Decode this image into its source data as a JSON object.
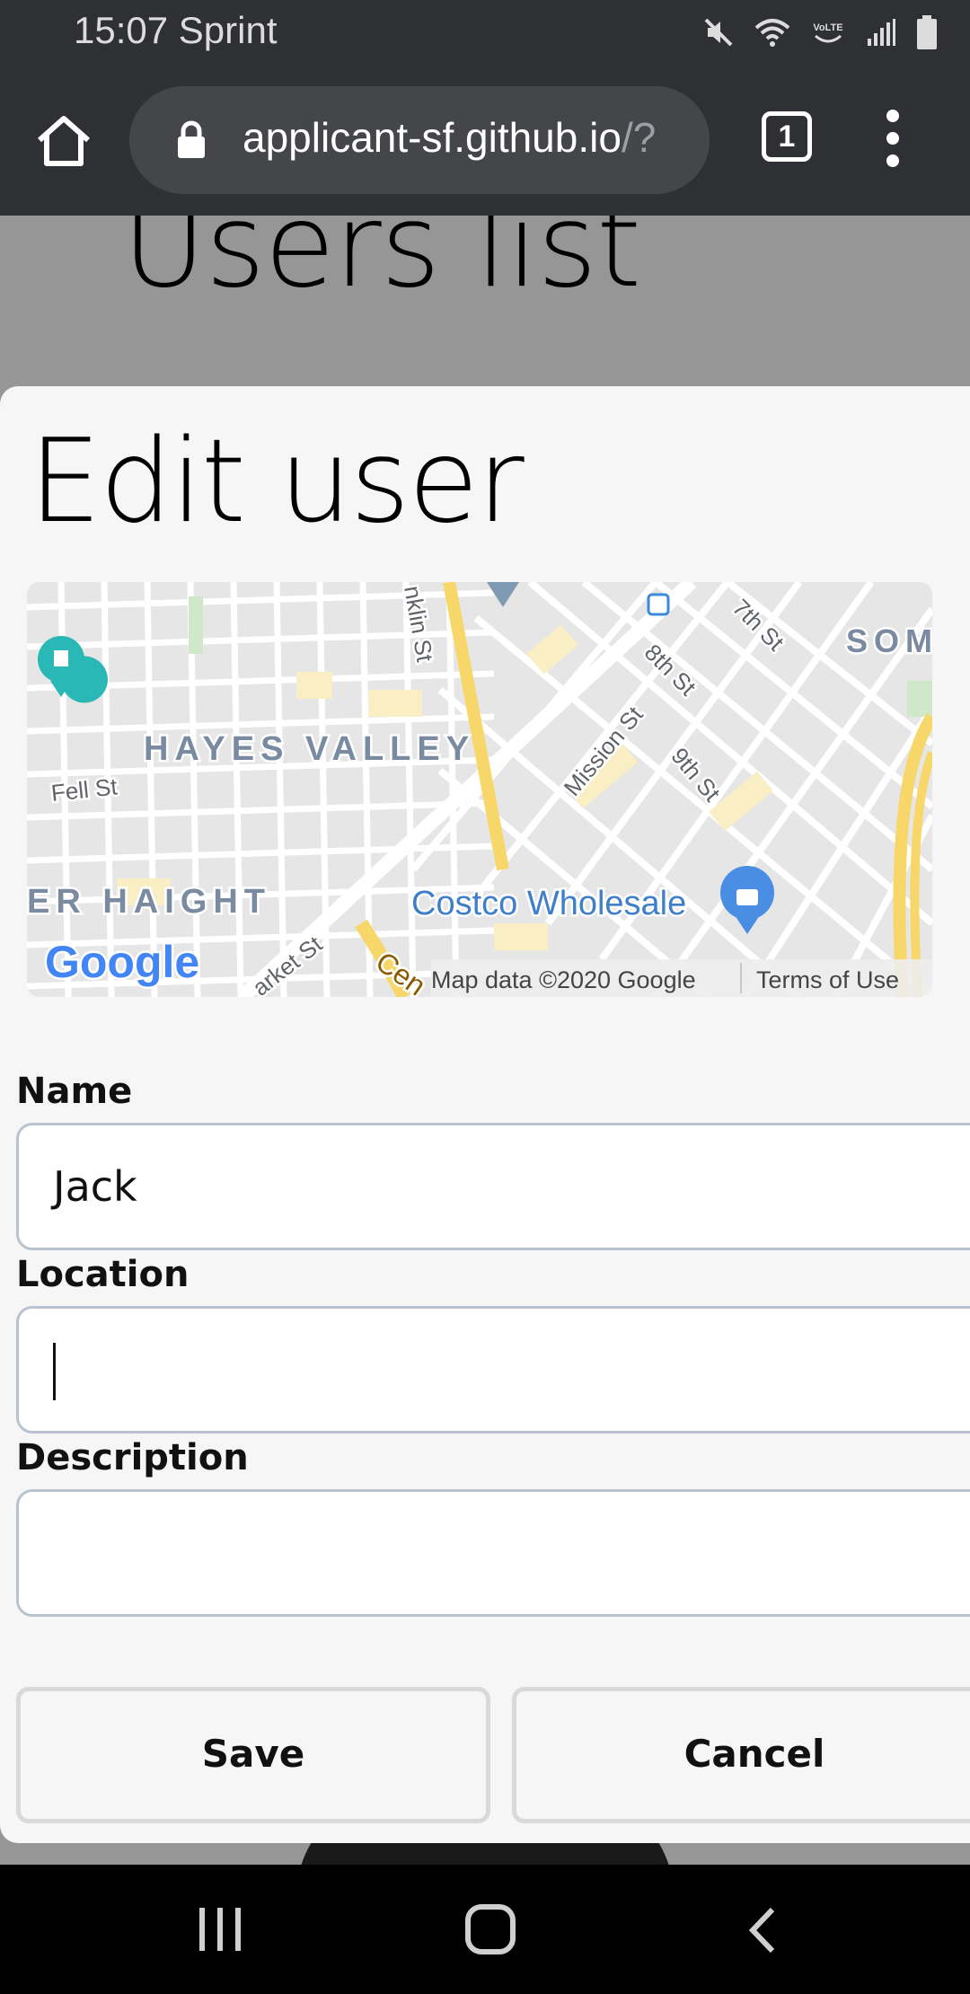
{
  "status_bar": {
    "time_carrier": "15:07 Sprint",
    "icons": [
      "mute-icon",
      "wifi-icon",
      "volte-icon",
      "signal-icon",
      "battery-icon"
    ],
    "volte_text": "VoLTE"
  },
  "browser": {
    "url_main": "applicant-sf.github.io",
    "url_rest": "/?",
    "tab_count": "1"
  },
  "page": {
    "title": "Users list"
  },
  "modal": {
    "title": "Edit user",
    "map": {
      "labels": {
        "hayes_valley": "HAYES VALLEY",
        "fell_st": "Fell St",
        "lower_haight": "ER HAIGHT",
        "costco": "Costco Wholesale",
        "franklin_st": "nklin St",
        "mission_st": "Mission St",
        "eighth_st": "8th St",
        "ninth_st": "9th St",
        "seventh_st": "7th St",
        "soma": "SOM",
        "market_st": "arket St",
        "central_fwy": "Cen",
        "google": "Google",
        "attribution": "Map data ©2020 Google",
        "terms": "Terms of Use"
      },
      "colors": {
        "road": "#ffffff",
        "block": "#e4e4e4",
        "highway": "#f7d76a",
        "poi": "#faefc4",
        "park": "#cfe9c8",
        "costco_pin": "#4a8ee3",
        "hotel_pin": "#2ab8b6"
      }
    },
    "fields": {
      "name": {
        "label": "Name",
        "value": "Jack"
      },
      "location": {
        "label": "Location",
        "value": ""
      },
      "description": {
        "label": "Description",
        "value": ""
      }
    },
    "buttons": {
      "save": "Save",
      "cancel": "Cancel"
    }
  }
}
